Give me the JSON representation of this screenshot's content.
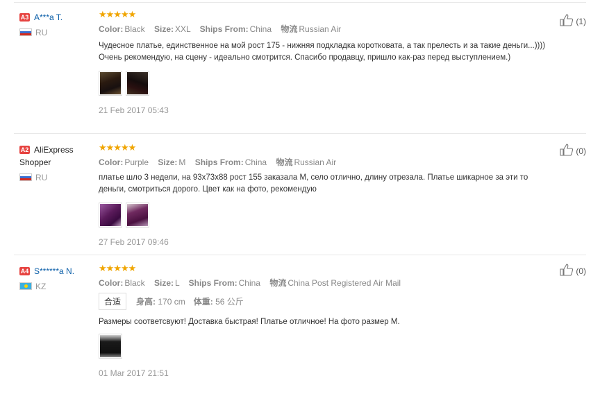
{
  "reviews": [
    {
      "badge": "A3",
      "name": "A***a T.",
      "country": "RU",
      "flag": "ru",
      "stars": "★★★★★",
      "attrs": [
        {
          "k": "Color:",
          "v": "Black"
        },
        {
          "k": "Size:",
          "v": "XXL"
        },
        {
          "k": "Ships From:",
          "v": "China"
        },
        {
          "k": "物流",
          "v": "Russian Air"
        }
      ],
      "text": "Чудесное платье, единственное на мой рост 175 - нижняя подкладка коротковата, а так прелесть и за такие деньги...)))) Очень рекомендую, на сцену - идеально смотрится. Спасибо продавцу, пришло как-раз перед выступлением.)",
      "date": "21 Feb 2017 05:43",
      "likes": "(1)"
    },
    {
      "badge": "A2",
      "name": "AliExpress Shopper",
      "country": "RU",
      "flag": "ru",
      "stars": "★★★★★",
      "attrs": [
        {
          "k": "Color:",
          "v": "Purple"
        },
        {
          "k": "Size:",
          "v": "M"
        },
        {
          "k": "Ships From:",
          "v": "China"
        },
        {
          "k": "物流",
          "v": "Russian Air"
        }
      ],
      "text": "платье шло 3 недели, на 93x73x88 рост 155 заказала М, село отлично, длину отрезала. Платье шикарное за эти то деньги, смотриться дорого. Цвет как на фото, рекомендую",
      "date": "27 Feb 2017 09:46",
      "likes": "(0)"
    },
    {
      "badge": "A4",
      "name": "S******a N.",
      "country": "KZ",
      "flag": "kz",
      "stars": "★★★★★",
      "attrs": [
        {
          "k": "Color:",
          "v": "Black"
        },
        {
          "k": "Size:",
          "v": "L"
        },
        {
          "k": "Ships From:",
          "v": "China"
        },
        {
          "k": "物流",
          "v": "China Post Registered Air Mail"
        }
      ],
      "fit": {
        "tag": "合适",
        "height_label": "身高:",
        "height": "170 cm",
        "weight_label": "体重:",
        "weight": "56 公斤"
      },
      "text": "Размеры соответсвуют! Доставка быстрая! Платье отличное! На фото размер М.",
      "date": "01 Mar 2017 21:51",
      "likes": "(0)"
    }
  ]
}
